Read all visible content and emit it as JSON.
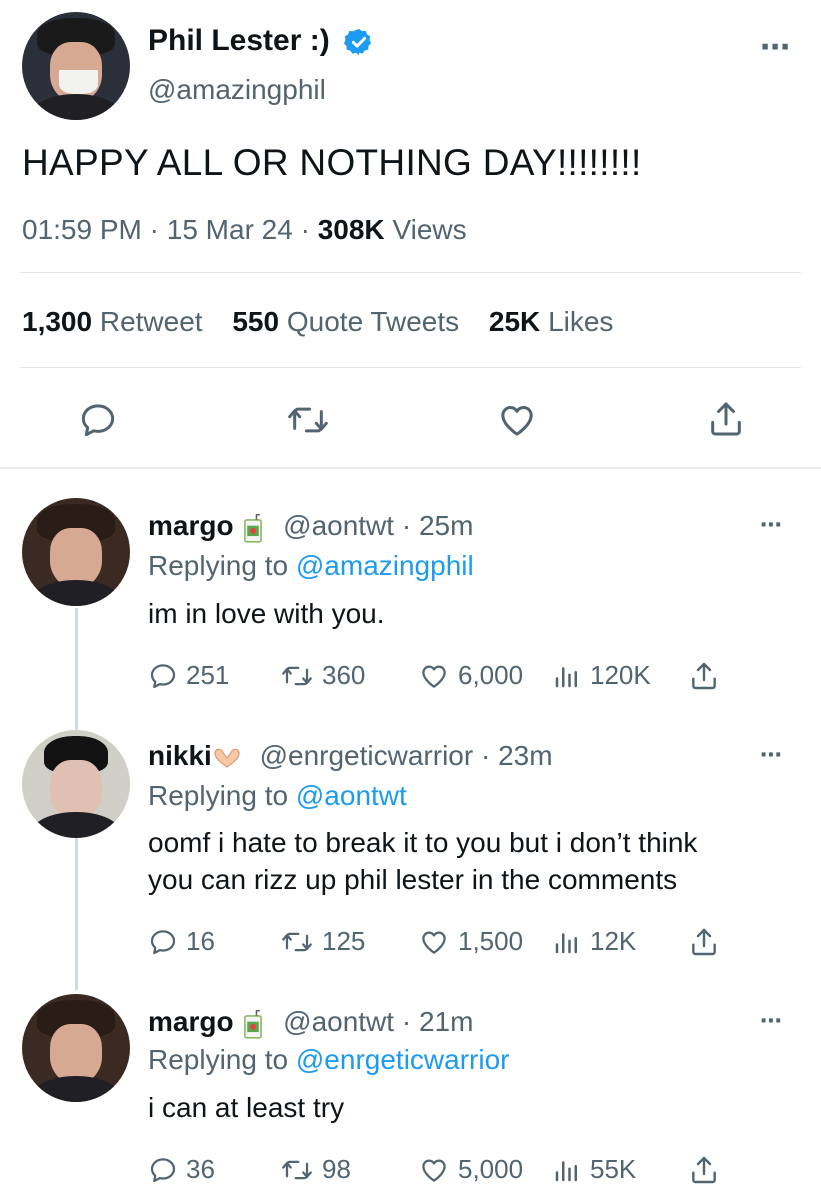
{
  "main_tweet": {
    "display_name": "Phil Lester :)",
    "handle": "@amazingphil",
    "text": "HAPPY ALL OR NOTHING DAY!!!!!!!!",
    "time": "01:59 PM",
    "date": "15 Mar 24",
    "separator": "·",
    "views_count": "308K",
    "views_label": "Views",
    "retweets_count": "1,300",
    "retweets_label": "Retweet",
    "quotes_count": "550",
    "quotes_label": "Quote Tweets",
    "likes_count": "25K",
    "likes_label": "Likes",
    "more_icon": "⋯"
  },
  "replies": [
    {
      "display_name": "margo",
      "handle": "@aontwt",
      "time": "· 25m",
      "replying_prefix": "Replying to",
      "replying_to": "@amazingphil",
      "text": "im in love with you.",
      "reply_count": "251",
      "retweet_count": "360",
      "like_count": "6,000",
      "view_count": "120K"
    },
    {
      "display_name": "nikki",
      "handle": "@enrgeticwarrior",
      "time": "· 23m",
      "replying_prefix": "Replying to",
      "replying_to": "@aontwt",
      "text_line1": "oomf i hate to break it to you but i don’t think",
      "text_line2": "you can rizz up phil lester in the comments",
      "reply_count": "16",
      "retweet_count": "125",
      "like_count": "1,500",
      "view_count": "12K"
    },
    {
      "display_name": "margo",
      "handle": "@aontwt",
      "time": "· 21m",
      "replying_prefix": "Replying to",
      "replying_to": "@enrgeticwarrior",
      "text": "i can at least try",
      "reply_count": "36",
      "retweet_count": "98",
      "like_count": "5,000",
      "view_count": "55K"
    }
  ],
  "colors": {
    "link": "#1d9bf0",
    "muted": "#536471",
    "text": "#0f1419",
    "verified": "#1d9bf0"
  },
  "icons": [
    "reply-icon",
    "retweet-icon",
    "like-icon",
    "share-icon",
    "views-icon",
    "verified-badge-icon",
    "more-icon",
    "juice-box-emoji",
    "heart-hands-emoji"
  ]
}
